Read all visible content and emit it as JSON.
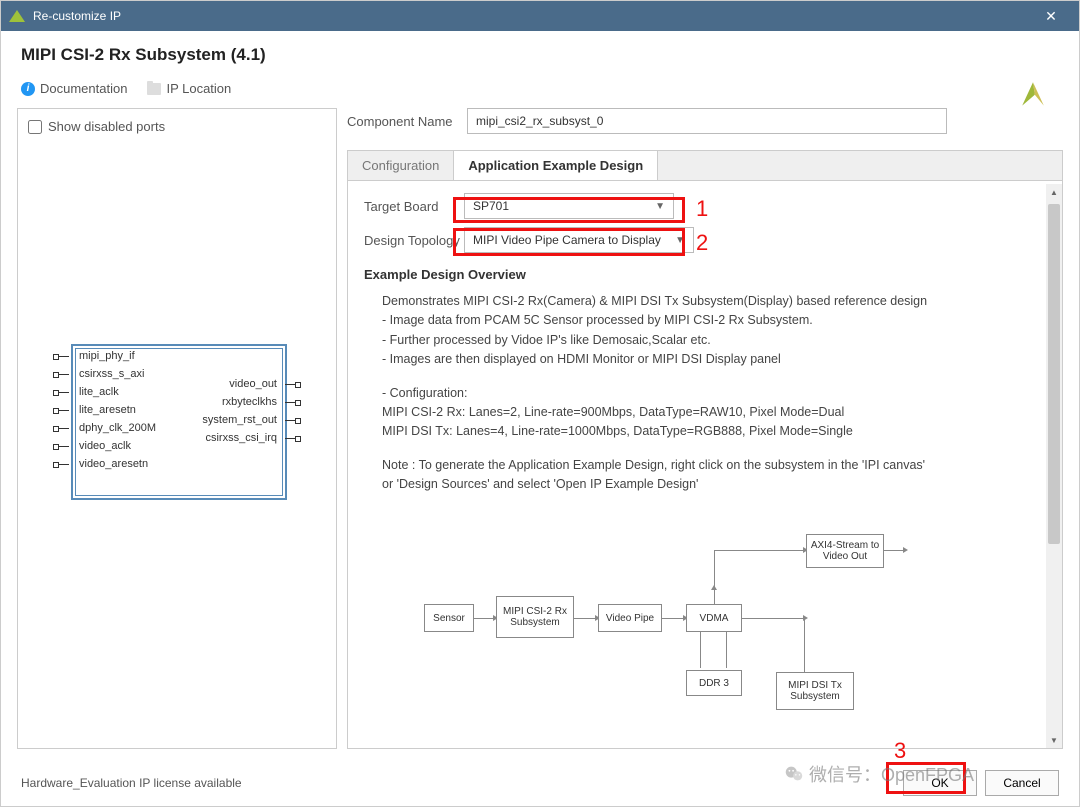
{
  "window": {
    "title": "Re-customize IP",
    "close": "✕"
  },
  "header": {
    "title": "MIPI CSI-2 Rx Subsystem (4.1)"
  },
  "toolbar": {
    "doc": "Documentation",
    "iploc": "IP Location"
  },
  "left": {
    "show_disabled": "Show disabled ports",
    "ports_left": [
      "mipi_phy_if",
      "csirxss_s_axi",
      "lite_aclk",
      "lite_aresetn",
      "dphy_clk_200M",
      "video_aclk",
      "video_aresetn"
    ],
    "ports_right": [
      "video_out",
      "rxbyteclkhs",
      "system_rst_out",
      "csirxss_csi_irq"
    ]
  },
  "form": {
    "comp_label": "Component Name",
    "comp_value": "mipi_csi2_rx_subsyst_0",
    "tabs": [
      "Configuration",
      "Application Example Design"
    ],
    "target_label": "Target Board",
    "target_value": "SP701",
    "topo_label": "Design Topology",
    "topo_value": "MIPI Video Pipe Camera to Display"
  },
  "overview": {
    "heading": "Example Design Overview",
    "l1": "Demonstrates MIPI CSI-2 Rx(Camera) & MIPI DSI Tx Subsystem(Display) based reference design",
    "l2": "- Image data from PCAM 5C Sensor processed by MIPI CSI-2 Rx Subsystem.",
    "l3": "- Further processed by Vidoe IP's like Demosaic,Scalar etc.",
    "l4": "- Images are then displayed on HDMI Monitor or MIPI DSI Display panel",
    "l5": "- Configuration:",
    "l6": "MIPI CSI-2 Rx: Lanes=2, Line-rate=900Mbps, DataType=RAW10, Pixel Mode=Dual",
    "l7": "MIPI DSI Tx: Lanes=4, Line-rate=1000Mbps, DataType=RGB888, Pixel Mode=Single",
    "l8": "Note : To generate the Application Example Design, right click on the subsystem in the 'IPI canvas'",
    "l9": "or 'Design Sources' and select 'Open IP Example Design'"
  },
  "diagram": {
    "sensor": "Sensor",
    "csi": "MIPI CSI-2 Rx Subsystem",
    "pipe": "Video Pipe",
    "vdma": "VDMA",
    "axi4": "AXI4-Stream to Video Out",
    "ddr": "DDR 3",
    "dsi": "MIPI DSI Tx Subsystem"
  },
  "footer": {
    "license": "Hardware_Evaluation IP license available",
    "ok": "OK",
    "cancel": "Cancel"
  },
  "annot": {
    "1": "1",
    "2": "2",
    "3": "3"
  },
  "watermark": "微信号：OpenFPGA"
}
